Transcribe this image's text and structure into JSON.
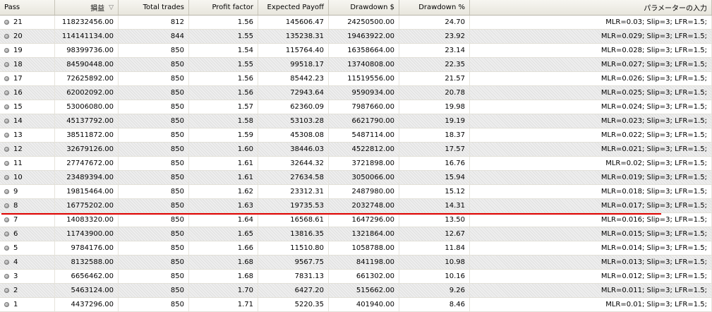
{
  "columns": [
    "Pass",
    "損益",
    "Total trades",
    "Profit factor",
    "Expected Payoff",
    "Drawdown $",
    "Drawdown %",
    "パラメーターの入力"
  ],
  "sort_icon": "▽",
  "rows": [
    {
      "pass": "21",
      "profit": "118232456.00",
      "trades": "812",
      "pf": "1.56",
      "payoff": "145606.47",
      "dd_usd": "24250500.00",
      "dd_pct": "24.70",
      "params": "MLR=0.03; Slip=3; LFR=1.5;"
    },
    {
      "pass": "20",
      "profit": "114141134.00",
      "trades": "844",
      "pf": "1.55",
      "payoff": "135238.31",
      "dd_usd": "19463922.00",
      "dd_pct": "23.92",
      "params": "MLR=0.029; Slip=3; LFR=1.5;"
    },
    {
      "pass": "19",
      "profit": "98399736.00",
      "trades": "850",
      "pf": "1.54",
      "payoff": "115764.40",
      "dd_usd": "16358664.00",
      "dd_pct": "23.14",
      "params": "MLR=0.028; Slip=3; LFR=1.5;"
    },
    {
      "pass": "18",
      "profit": "84590448.00",
      "trades": "850",
      "pf": "1.55",
      "payoff": "99518.17",
      "dd_usd": "13740808.00",
      "dd_pct": "22.35",
      "params": "MLR=0.027; Slip=3; LFR=1.5;"
    },
    {
      "pass": "17",
      "profit": "72625892.00",
      "trades": "850",
      "pf": "1.56",
      "payoff": "85442.23",
      "dd_usd": "11519556.00",
      "dd_pct": "21.57",
      "params": "MLR=0.026; Slip=3; LFR=1.5;"
    },
    {
      "pass": "16",
      "profit": "62002092.00",
      "trades": "850",
      "pf": "1.56",
      "payoff": "72943.64",
      "dd_usd": "9590934.00",
      "dd_pct": "20.78",
      "params": "MLR=0.025; Slip=3; LFR=1.5;"
    },
    {
      "pass": "15",
      "profit": "53006080.00",
      "trades": "850",
      "pf": "1.57",
      "payoff": "62360.09",
      "dd_usd": "7987660.00",
      "dd_pct": "19.98",
      "params": "MLR=0.024; Slip=3; LFR=1.5;"
    },
    {
      "pass": "14",
      "profit": "45137792.00",
      "trades": "850",
      "pf": "1.58",
      "payoff": "53103.28",
      "dd_usd": "6621790.00",
      "dd_pct": "19.19",
      "params": "MLR=0.023; Slip=3; LFR=1.5;"
    },
    {
      "pass": "13",
      "profit": "38511872.00",
      "trades": "850",
      "pf": "1.59",
      "payoff": "45308.08",
      "dd_usd": "5487114.00",
      "dd_pct": "18.37",
      "params": "MLR=0.022; Slip=3; LFR=1.5;"
    },
    {
      "pass": "12",
      "profit": "32679126.00",
      "trades": "850",
      "pf": "1.60",
      "payoff": "38446.03",
      "dd_usd": "4522812.00",
      "dd_pct": "17.57",
      "params": "MLR=0.021; Slip=3; LFR=1.5;"
    },
    {
      "pass": "11",
      "profit": "27747672.00",
      "trades": "850",
      "pf": "1.61",
      "payoff": "32644.32",
      "dd_usd": "3721898.00",
      "dd_pct": "16.76",
      "params": "MLR=0.02; Slip=3; LFR=1.5;"
    },
    {
      "pass": "10",
      "profit": "23489394.00",
      "trades": "850",
      "pf": "1.61",
      "payoff": "27634.58",
      "dd_usd": "3050066.00",
      "dd_pct": "15.94",
      "params": "MLR=0.019; Slip=3; LFR=1.5;"
    },
    {
      "pass": "9",
      "profit": "19815464.00",
      "trades": "850",
      "pf": "1.62",
      "payoff": "23312.31",
      "dd_usd": "2487980.00",
      "dd_pct": "15.12",
      "params": "MLR=0.018; Slip=3; LFR=1.5;"
    },
    {
      "pass": "8",
      "profit": "16775202.00",
      "trades": "850",
      "pf": "1.63",
      "payoff": "19735.53",
      "dd_usd": "2032748.00",
      "dd_pct": "14.31",
      "params": "MLR=0.017; Slip=3; LFR=1.5;"
    },
    {
      "pass": "7",
      "profit": "14083320.00",
      "trades": "850",
      "pf": "1.64",
      "payoff": "16568.61",
      "dd_usd": "1647296.00",
      "dd_pct": "13.50",
      "params": "MLR=0.016; Slip=3; LFR=1.5;"
    },
    {
      "pass": "6",
      "profit": "11743900.00",
      "trades": "850",
      "pf": "1.65",
      "payoff": "13816.35",
      "dd_usd": "1321864.00",
      "dd_pct": "12.67",
      "params": "MLR=0.015; Slip=3; LFR=1.5;"
    },
    {
      "pass": "5",
      "profit": "9784176.00",
      "trades": "850",
      "pf": "1.66",
      "payoff": "11510.80",
      "dd_usd": "1058788.00",
      "dd_pct": "11.84",
      "params": "MLR=0.014; Slip=3; LFR=1.5;"
    },
    {
      "pass": "4",
      "profit": "8132588.00",
      "trades": "850",
      "pf": "1.68",
      "payoff": "9567.75",
      "dd_usd": "841198.00",
      "dd_pct": "10.98",
      "params": "MLR=0.013; Slip=3; LFR=1.5;"
    },
    {
      "pass": "3",
      "profit": "6656462.00",
      "trades": "850",
      "pf": "1.68",
      "payoff": "7831.13",
      "dd_usd": "661302.00",
      "dd_pct": "10.16",
      "params": "MLR=0.012; Slip=3; LFR=1.5;"
    },
    {
      "pass": "2",
      "profit": "5463124.00",
      "trades": "850",
      "pf": "1.70",
      "payoff": "6427.20",
      "dd_usd": "515662.00",
      "dd_pct": "9.26",
      "params": "MLR=0.011; Slip=3; LFR=1.5;"
    },
    {
      "pass": "1",
      "profit": "4437296.00",
      "trades": "850",
      "pf": "1.71",
      "payoff": "5220.35",
      "dd_usd": "401940.00",
      "dd_pct": "8.46",
      "params": "MLR=0.01; Slip=3; LFR=1.5;"
    }
  ],
  "highlight_color": "#e00000"
}
